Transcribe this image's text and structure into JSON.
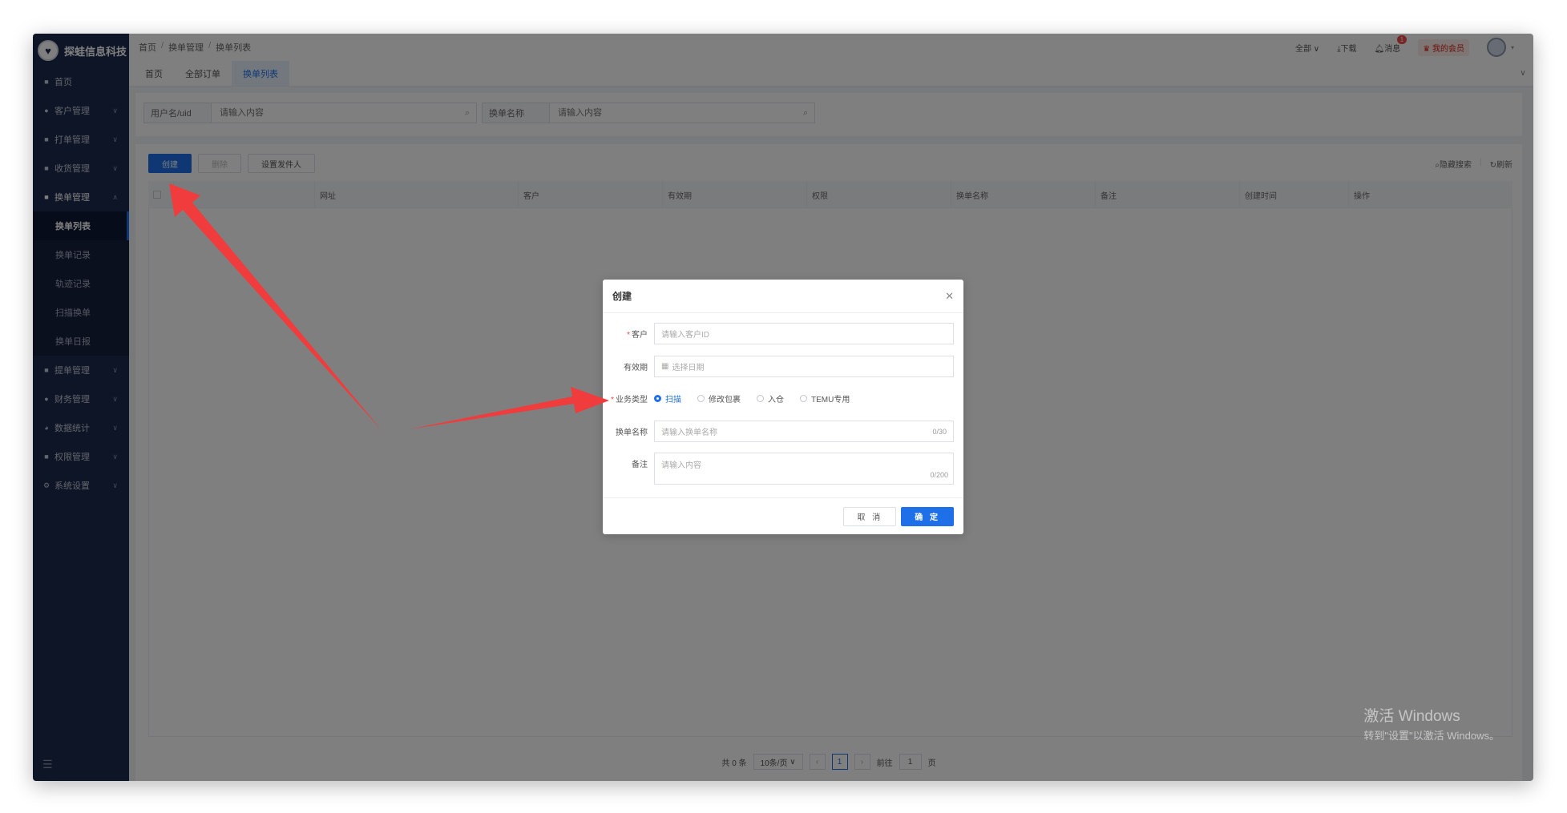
{
  "brand": {
    "name": "探蛙信息科技"
  },
  "sidebar": {
    "items": [
      {
        "label": "首页",
        "icon": "home-icon"
      },
      {
        "label": "客户管理",
        "icon": "user-icon"
      },
      {
        "label": "打单管理",
        "icon": "print-icon"
      },
      {
        "label": "收货管理",
        "icon": "truck-icon"
      },
      {
        "label": "换单管理",
        "icon": "swap-icon"
      },
      {
        "label": "提单管理",
        "icon": "doc-icon"
      },
      {
        "label": "财务管理",
        "icon": "finance-icon"
      },
      {
        "label": "数据统计",
        "icon": "chart-icon"
      },
      {
        "label": "权限管理",
        "icon": "lock-icon"
      },
      {
        "label": "系统设置",
        "icon": "gear-icon"
      }
    ],
    "sub_items": [
      "换单列表",
      "换单记录",
      "轨迹记录",
      "扫描换单",
      "换单日报"
    ]
  },
  "header": {
    "breadcrumb": [
      "首页",
      "换单管理",
      "换单列表"
    ],
    "scope": "全部",
    "download": "下载",
    "messages": "消息",
    "message_count": "1",
    "vip": "我的会员"
  },
  "tags": [
    "首页",
    "全部订单",
    "换单列表"
  ],
  "search": {
    "field1_label": "用户名/uid",
    "field1_placeholder": "请输入内容",
    "field2_label": "换单名称",
    "field2_placeholder": "请输入内容"
  },
  "toolbar": {
    "create": "创建",
    "delete": "删除",
    "set_sender": "设置发件人",
    "hide_search": "隐藏搜索",
    "refresh": "刷新"
  },
  "table": {
    "columns": [
      "网址",
      "客户",
      "有效期",
      "权限",
      "换单名称",
      "备注",
      "创建时间",
      "操作"
    ]
  },
  "pagination": {
    "total": "共 0 条",
    "page_size": "10条/页",
    "current": "1",
    "goto_label": "前往",
    "goto_value": "1",
    "page_unit": "页"
  },
  "dialog": {
    "title": "创建",
    "customer_label": "客户",
    "customer_placeholder": "请输入客户ID",
    "validity_label": "有效期",
    "validity_placeholder": "选择日期",
    "biz_type_label": "业务类型",
    "biz_options": [
      "扫描",
      "修改包裹",
      "入仓",
      "TEMU专用"
    ],
    "name_label": "换单名称",
    "name_placeholder": "请输入换单名称",
    "name_count": "0/30",
    "remark_label": "备注",
    "remark_placeholder": "请输入内容",
    "remark_count": "0/200",
    "cancel": "取 消",
    "confirm": "确 定"
  },
  "watermark": {
    "line1": "激活 Windows",
    "line2": "转到\"设置\"以激活 Windows。"
  },
  "colors": {
    "primary": "#1f6fe8",
    "sidebar": "#1d2a4d",
    "arrow": "#f03c3c",
    "required": "#f04a4a"
  }
}
